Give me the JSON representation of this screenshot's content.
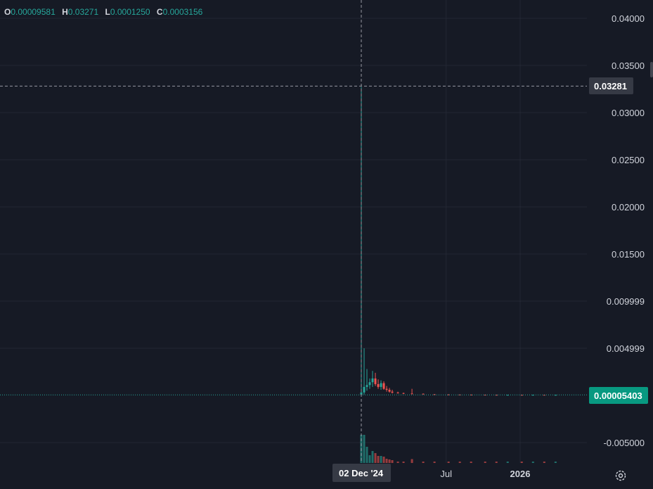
{
  "ohlc": {
    "open_label": "O",
    "open": "0.00009581",
    "high_label": "H",
    "high": "0.03271",
    "low_label": "L",
    "low": "0.0001250",
    "close_label": "C",
    "close": "0.0003156"
  },
  "colors": {
    "background": "#161a25",
    "grid": "#232733",
    "up": "#26a69a",
    "down": "#ef5350",
    "text": "#d1d4dc",
    "crosshair_badge": "#363a45",
    "last_price_badge": "#089981"
  },
  "chart_data": {
    "type": "candlestick",
    "ylim": [
      -0.0062,
      0.0418
    ],
    "y_tick_labels": [
      "0.04000",
      "0.03500",
      "0.03000",
      "0.02500",
      "0.02000",
      "0.01500",
      "0.009999",
      "0.004999",
      "-0.005000"
    ],
    "y_tick_values": [
      0.04,
      0.035,
      0.03,
      0.025,
      0.02,
      0.015,
      0.01,
      0.005,
      -0.005
    ],
    "x_tick_labels": [
      "Jul",
      "2026"
    ],
    "crosshair_x_label": "02 Dec '24",
    "crosshair_y_label": "0.03281",
    "crosshair_y_value": 0.03281,
    "last_price_label": "0.00005403",
    "last_price_value": 5.403e-05,
    "grid": true,
    "candles": [
      {
        "date": "2024-12-02",
        "open": 9.581e-05,
        "high": 0.03271,
        "low": 0.000125,
        "close": 0.0003156
      },
      {
        "date": "2024-12-09",
        "open": 0.0003156,
        "high": 0.005,
        "low": 0.0001,
        "close": 0.0009
      },
      {
        "date": "2024-12-16",
        "open": 0.0009,
        "high": 0.0028,
        "low": 0.0005,
        "close": 0.0011
      },
      {
        "date": "2024-12-23",
        "open": 0.0011,
        "high": 0.0018,
        "low": 0.0007,
        "close": 0.0014
      },
      {
        "date": "2024-12-30",
        "open": 0.0014,
        "high": 0.0026,
        "low": 0.0009,
        "close": 0.0018
      },
      {
        "date": "2025-01-06",
        "open": 0.0018,
        "high": 0.0024,
        "low": 0.001,
        "close": 0.0012
      },
      {
        "date": "2025-01-13",
        "open": 0.0012,
        "high": 0.0017,
        "low": 0.0007,
        "close": 0.0009
      },
      {
        "date": "2025-01-20",
        "open": 0.0009,
        "high": 0.0016,
        "low": 0.0006,
        "close": 0.0013
      },
      {
        "date": "2025-01-27",
        "open": 0.0013,
        "high": 0.0015,
        "low": 0.0006,
        "close": 0.0007
      },
      {
        "date": "2025-02-03",
        "open": 0.0007,
        "high": 0.001,
        "low": 0.0004,
        "close": 0.0006
      },
      {
        "date": "2025-02-10",
        "open": 0.0006,
        "high": 0.0008,
        "low": 0.0003,
        "close": 0.0004
      },
      {
        "date": "2025-02-17",
        "open": 0.0004,
        "high": 0.0006,
        "low": 0.0002,
        "close": 0.0003
      },
      {
        "date": "2025-03-03",
        "open": 0.0003,
        "high": 0.0004,
        "low": 0.0002,
        "close": 0.00025
      },
      {
        "date": "2025-03-17",
        "open": 0.00025,
        "high": 0.0003,
        "low": 0.00015,
        "close": 0.0002
      },
      {
        "date": "2025-04-07",
        "open": 0.0002,
        "high": 0.0007,
        "low": 0.00015,
        "close": 0.00018
      },
      {
        "date": "2025-05-05",
        "open": 0.00018,
        "high": 0.0002,
        "low": 0.0001,
        "close": 0.00012
      },
      {
        "date": "2025-06-02",
        "open": 0.00012,
        "high": 0.00015,
        "low": 8e-05,
        "close": 0.0001
      },
      {
        "date": "2025-07-07",
        "open": 0.0001,
        "high": 0.00012,
        "low": 7e-05,
        "close": 9e-05
      },
      {
        "date": "2025-08-04",
        "open": 9e-05,
        "high": 0.0001,
        "low": 6e-05,
        "close": 8e-05
      },
      {
        "date": "2025-09-01",
        "open": 8e-05,
        "high": 0.0001,
        "low": 6e-05,
        "close": 7e-05
      },
      {
        "date": "2025-10-06",
        "open": 7e-05,
        "high": 9e-05,
        "low": 5e-05,
        "close": 6e-05
      },
      {
        "date": "2025-11-03",
        "open": 6e-05,
        "high": 8e-05,
        "low": 4e-05,
        "close": 5e-05
      },
      {
        "date": "2025-12-01",
        "open": 5e-05,
        "high": 7e-05,
        "low": 4e-05,
        "close": 6e-05
      },
      {
        "date": "2026-01-05",
        "open": 6e-05,
        "high": 7e-05,
        "low": 4e-05,
        "close": 5e-05
      },
      {
        "date": "2026-02-02",
        "open": 5e-05,
        "high": 7e-05,
        "low": 4e-05,
        "close": 6e-05
      },
      {
        "date": "2026-03-02",
        "open": 6e-05,
        "high": 7e-05,
        "low": 4e-05,
        "close": 5e-05
      },
      {
        "date": "2026-03-30",
        "open": 5e-05,
        "high": 6e-05,
        "low": 4e-05,
        "close": 5.403e-05
      }
    ]
  }
}
